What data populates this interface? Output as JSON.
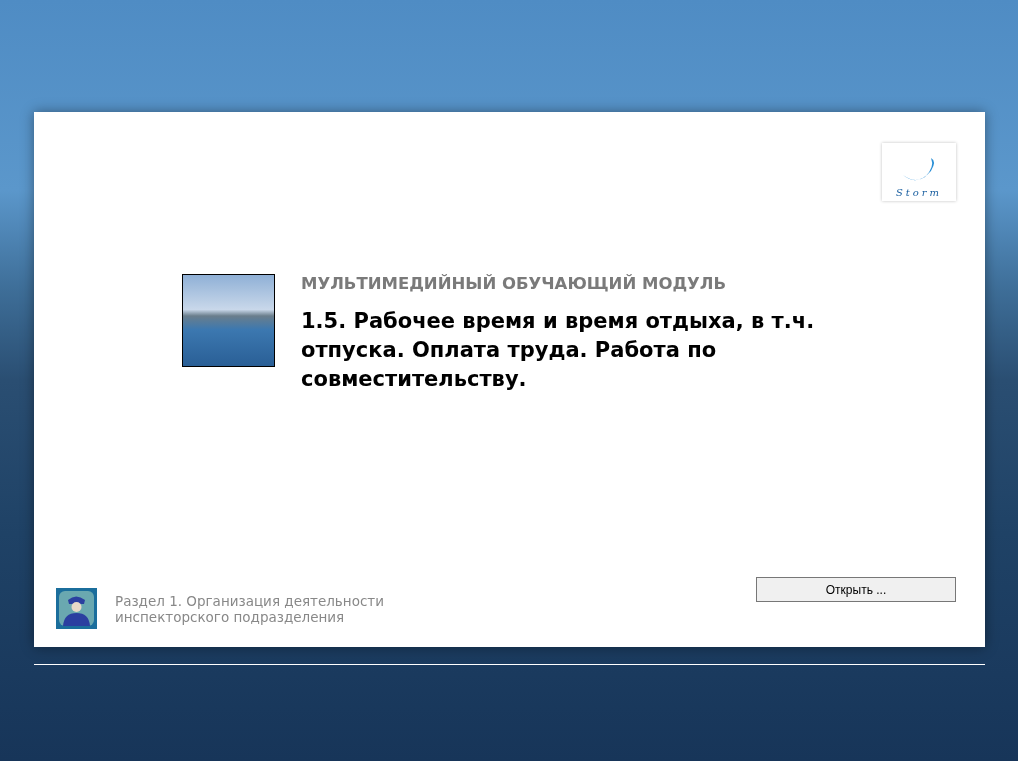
{
  "logo": {
    "text": "Storm"
  },
  "module": {
    "label": "МУЛЬТИМЕДИЙНЫЙ ОБУЧАЮЩИЙ МОДУЛЬ",
    "title": "1.5. Рабочее время и время отдыха, в т.ч. отпуска. Оплата труда. Работа по совместительству."
  },
  "section": {
    "text": "Раздел 1. Организация деятельности инспекторского подразделения"
  },
  "buttons": [
    {
      "label": "Открыть ..."
    }
  ]
}
